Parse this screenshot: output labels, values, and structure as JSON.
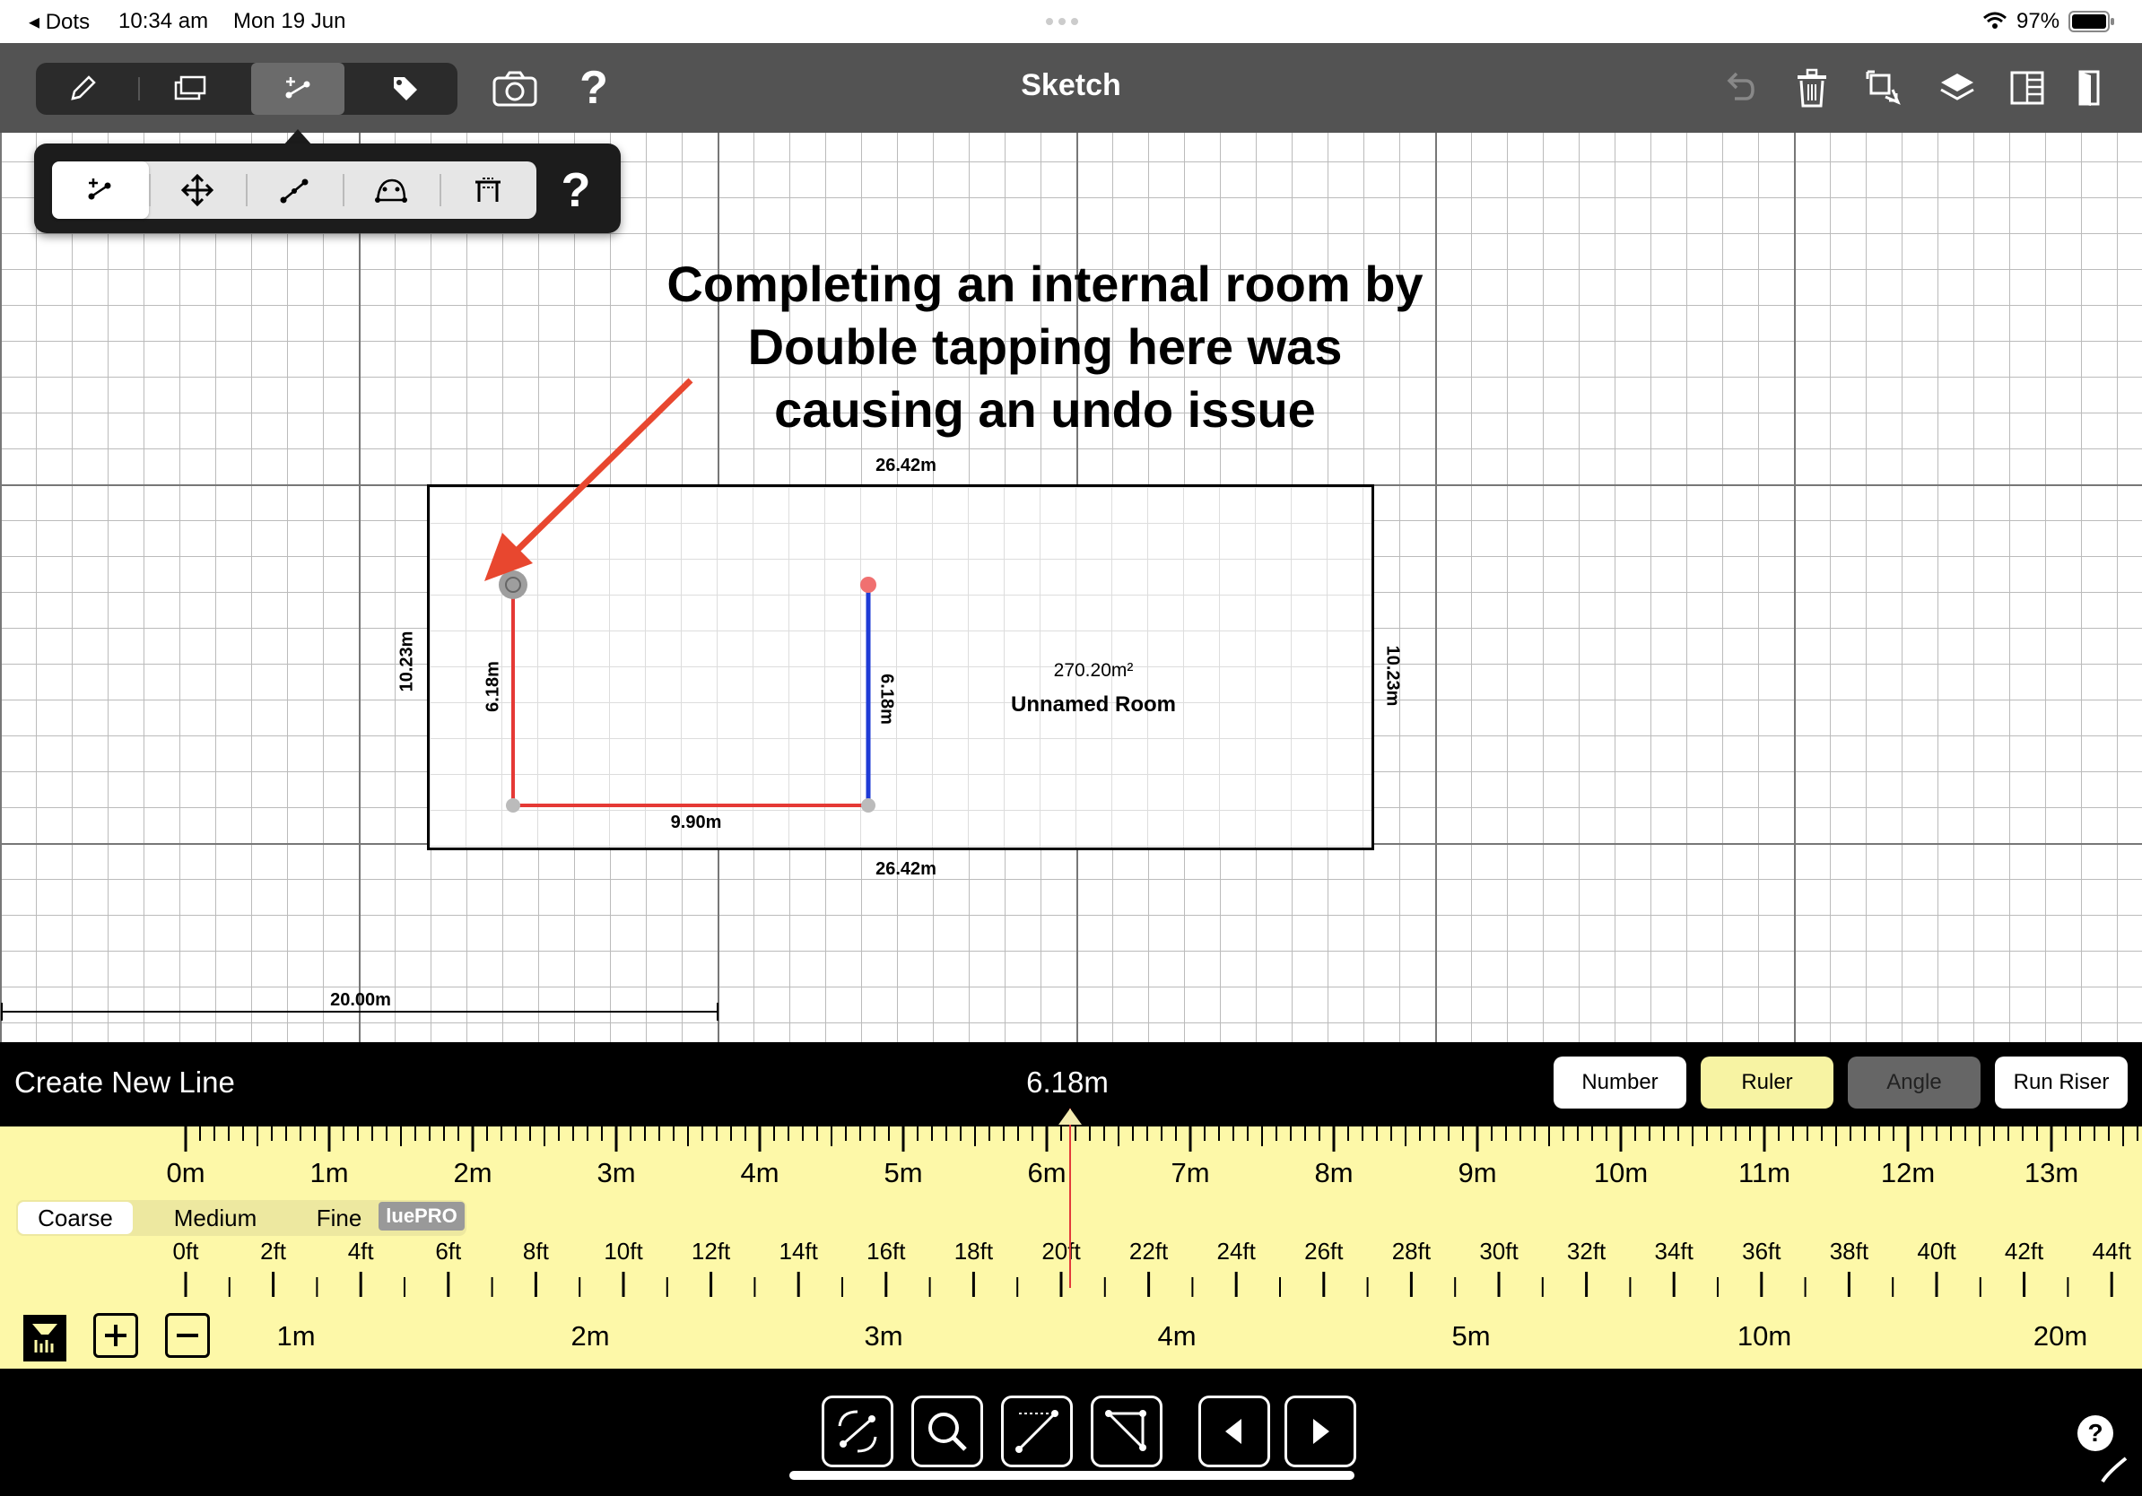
{
  "status_bar": {
    "back_app": "◂ Dots",
    "time": "10:34 am",
    "date": "Mon 19 Jun",
    "battery": "97%"
  },
  "header": {
    "title": "Sketch",
    "help": "?"
  },
  "popover": {
    "help": "?"
  },
  "annotation": {
    "line1": "Completing an internal room by",
    "line2": "Double tapping here was",
    "line3": "causing an undo issue"
  },
  "room": {
    "top_dim": "26.42m",
    "bottom_dim": "26.42m",
    "left_dim": "10.23m",
    "right_dim": "10.23m",
    "area": "270.20m²",
    "name": "Unnamed Room",
    "inner_left_dim": "6.18m",
    "inner_bottom_dim": "9.90m",
    "inner_right_dim": "6.18m"
  },
  "scale_bar": {
    "label": "20.00m"
  },
  "panel": {
    "title": "Create New Line",
    "value": "6.18m",
    "modes": [
      "Number",
      "Ruler",
      "Angle",
      "Run Riser"
    ]
  },
  "ruler": {
    "metres": [
      "0m",
      "1m",
      "2m",
      "3m",
      "4m",
      "5m",
      "6m",
      "7m",
      "8m",
      "9m",
      "10m",
      "11m",
      "12m",
      "13m"
    ],
    "feet": [
      "0ft",
      "2ft",
      "4ft",
      "6ft",
      "8ft",
      "10ft",
      "12ft",
      "14ft",
      "16ft",
      "18ft",
      "20ft",
      "22ft",
      "24ft",
      "26ft",
      "28ft",
      "30ft",
      "32ft",
      "34ft",
      "36ft",
      "38ft",
      "40ft",
      "42ft",
      "44ft"
    ],
    "granularity": [
      "Coarse",
      "Medium",
      "Fine"
    ],
    "badge": "luePRO",
    "zoom_levels": [
      "1m",
      "2m",
      "3m",
      "4m",
      "5m",
      "10m",
      "20m"
    ]
  },
  "dock": {
    "help": "?"
  },
  "colors": {
    "header": "#535353",
    "ruler": "#fdf8a8",
    "red_line": "#e53935",
    "blue_line": "#1e3bd6",
    "arrow": "#e8472f"
  }
}
